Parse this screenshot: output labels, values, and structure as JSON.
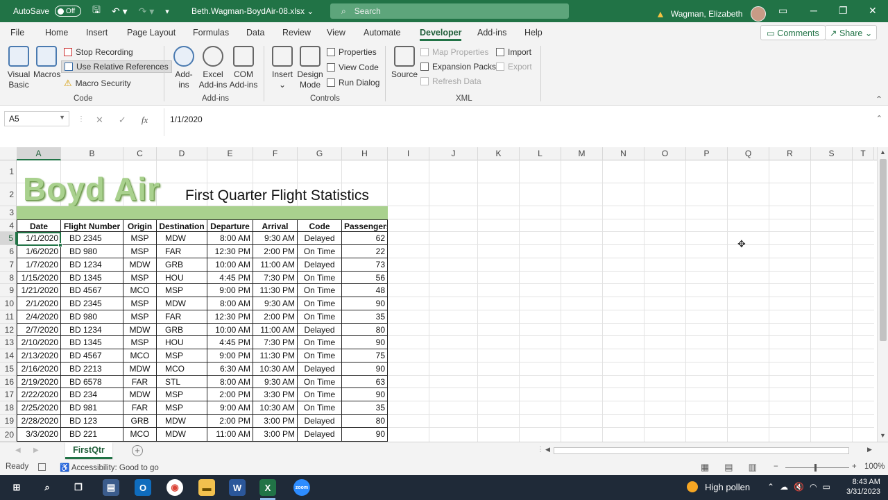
{
  "titlebar": {
    "autosave_label": "AutoSave",
    "autosave_state": "Off",
    "filename": "Beth.Wagman-BoydAir-08.xlsx",
    "search_placeholder": "Search",
    "user_name": "Wagman, Elizabeth"
  },
  "tabs": [
    "File",
    "Home",
    "Insert",
    "Page Layout",
    "Formulas",
    "Data",
    "Review",
    "View",
    "Automate",
    "Developer",
    "Add-ins",
    "Help"
  ],
  "active_tab": "Developer",
  "top_buttons": {
    "comments": "Comments",
    "share": "Share"
  },
  "ribbon": {
    "code": {
      "label": "Code",
      "visual_basic": [
        "Visual",
        "Basic"
      ],
      "macros": "Macros",
      "stop_recording": "Stop Recording",
      "use_relative": "Use Relative References",
      "macro_security": "Macro Security"
    },
    "addins": {
      "label": "Add-ins",
      "addins": [
        "Add-",
        "ins"
      ],
      "excel_addins": [
        "Excel",
        "Add-ins"
      ],
      "com_addins": [
        "COM",
        "Add-ins"
      ]
    },
    "controls": {
      "label": "Controls",
      "insert": "Insert",
      "design_mode": [
        "Design",
        "Mode"
      ],
      "properties": "Properties",
      "view_code": "View Code",
      "run_dialog": "Run Dialog"
    },
    "xml": {
      "label": "XML",
      "source": "Source",
      "map_properties": "Map Properties",
      "expansion_packs": "Expansion Packs",
      "refresh_data": "Refresh Data",
      "import": "Import",
      "export": "Export"
    }
  },
  "formula_bar": {
    "name_box": "A5",
    "fx": "fx",
    "value": "1/1/2020"
  },
  "columns": [
    "A",
    "B",
    "C",
    "D",
    "E",
    "F",
    "G",
    "H",
    "I",
    "J",
    "K",
    "L",
    "M",
    "N",
    "O",
    "P",
    "Q",
    "R",
    "S",
    "T"
  ],
  "rows": [
    "1",
    "2",
    "3",
    "4",
    "5",
    "6",
    "7",
    "8",
    "9",
    "10",
    "11",
    "12",
    "13",
    "14",
    "15",
    "16",
    "17",
    "18",
    "19",
    "20"
  ],
  "sheet_content": {
    "logo": "Boyd Air",
    "title": "First Quarter Flight Statistics",
    "headers": [
      "Date",
      "Flight Number",
      "Origin",
      "Destination",
      "Departure",
      "Arrival",
      "Code",
      "Passengers"
    ],
    "data": [
      [
        "1/1/2020",
        "BD 2345",
        "MSP",
        "MDW",
        "8:00 AM",
        "9:30 AM",
        "Delayed",
        "62"
      ],
      [
        "1/6/2020",
        "BD 980",
        "MSP",
        "FAR",
        "12:30 PM",
        "2:00 PM",
        "On Time",
        "22"
      ],
      [
        "1/7/2020",
        "BD 1234",
        "MDW",
        "GRB",
        "10:00 AM",
        "11:00 AM",
        "Delayed",
        "73"
      ],
      [
        "1/15/2020",
        "BD 1345",
        "MSP",
        "HOU",
        "4:45 PM",
        "7:30 PM",
        "On Time",
        "56"
      ],
      [
        "1/21/2020",
        "BD 4567",
        "MCO",
        "MSP",
        "9:00 PM",
        "11:30 PM",
        "On Time",
        "48"
      ],
      [
        "2/1/2020",
        "BD 2345",
        "MSP",
        "MDW",
        "8:00 AM",
        "9:30 AM",
        "On Time",
        "90"
      ],
      [
        "2/4/2020",
        "BD 980",
        "MSP",
        "FAR",
        "12:30 PM",
        "2:00 PM",
        "On Time",
        "35"
      ],
      [
        "2/7/2020",
        "BD 1234",
        "MDW",
        "GRB",
        "10:00 AM",
        "11:00 AM",
        "Delayed",
        "80"
      ],
      [
        "2/10/2020",
        "BD 1345",
        "MSP",
        "HOU",
        "4:45 PM",
        "7:30 PM",
        "On Time",
        "90"
      ],
      [
        "2/13/2020",
        "BD 4567",
        "MCO",
        "MSP",
        "9:00 PM",
        "11:30 PM",
        "On Time",
        "75"
      ],
      [
        "2/16/2020",
        "BD 2213",
        "MDW",
        "MCO",
        "6:30 AM",
        "10:30 AM",
        "Delayed",
        "90"
      ],
      [
        "2/19/2020",
        "BD 6578",
        "FAR",
        "STL",
        "8:00 AM",
        "9:30 AM",
        "On Time",
        "63"
      ],
      [
        "2/22/2020",
        "BD 234",
        "MDW",
        "MSP",
        "2:00 PM",
        "3:30 PM",
        "On Time",
        "90"
      ],
      [
        "2/25/2020",
        "BD 981",
        "FAR",
        "MSP",
        "9:00 AM",
        "10:30 AM",
        "On Time",
        "35"
      ],
      [
        "2/28/2020",
        "BD 123",
        "GRB",
        "MDW",
        "2:00 PM",
        "3:00 PM",
        "Delayed",
        "80"
      ],
      [
        "3/3/2020",
        "BD 221",
        "MCO",
        "MDW",
        "11:00 AM",
        "3:00 PM",
        "Delayed",
        "90"
      ]
    ]
  },
  "sheet_tab": "FirstQtr",
  "status": {
    "ready": "Ready",
    "accessibility": "Accessibility: Good to go",
    "zoom": "100%"
  },
  "taskbar": {
    "weather": "High pollen",
    "time": "8:43 AM",
    "date": "3/31/2023"
  }
}
